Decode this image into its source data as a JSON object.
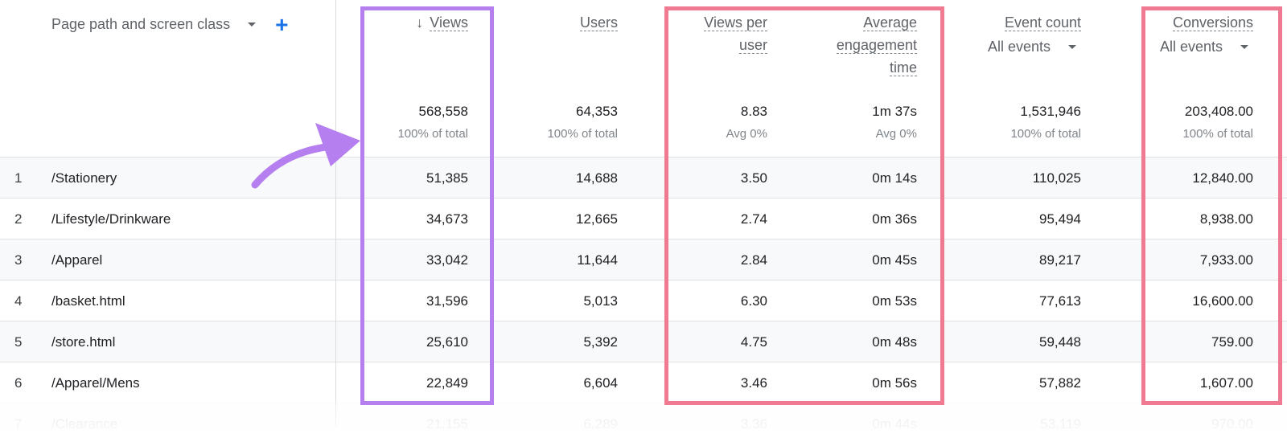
{
  "dimension": {
    "label": "Page path and screen class",
    "dropdown_icon": "caret-down-icon",
    "add_icon": "plus-icon"
  },
  "columns": [
    {
      "key": "views",
      "label_lines": [
        "Views"
      ],
      "sort_icon": "arrow-down-icon",
      "total": "568,558",
      "total_sub": "100% of total"
    },
    {
      "key": "users",
      "label_lines": [
        "Users"
      ],
      "total": "64,353",
      "total_sub": "100% of total"
    },
    {
      "key": "views_per_user",
      "label_lines": [
        "Views per",
        "user"
      ],
      "total": "8.83",
      "total_sub": "Avg 0%"
    },
    {
      "key": "avg_engagement_time",
      "label_lines": [
        "Average",
        "engagement",
        "time"
      ],
      "total": "1m 37s",
      "total_sub": "Avg 0%"
    },
    {
      "key": "event_count",
      "label_lines": [
        "Event count"
      ],
      "filter": "All events",
      "total": "1,531,946",
      "total_sub": "100% of total"
    },
    {
      "key": "conversions",
      "label_lines": [
        "Conversions"
      ],
      "filter": "All events",
      "total": "203,408.00",
      "total_sub": "100% of total"
    }
  ],
  "rows": [
    {
      "index": "1",
      "path": "/Stationery",
      "views": "51,385",
      "users": "14,688",
      "views_per_user": "3.50",
      "avg_engagement_time": "0m 14s",
      "event_count": "110,025",
      "conversions": "12,840.00"
    },
    {
      "index": "2",
      "path": "/Lifestyle/Drinkware",
      "views": "34,673",
      "users": "12,665",
      "views_per_user": "2.74",
      "avg_engagement_time": "0m 36s",
      "event_count": "95,494",
      "conversions": "8,938.00"
    },
    {
      "index": "3",
      "path": "/Apparel",
      "views": "33,042",
      "users": "11,644",
      "views_per_user": "2.84",
      "avg_engagement_time": "0m 45s",
      "event_count": "89,217",
      "conversions": "7,933.00"
    },
    {
      "index": "4",
      "path": "/basket.html",
      "views": "31,596",
      "users": "5,013",
      "views_per_user": "6.30",
      "avg_engagement_time": "0m 53s",
      "event_count": "77,613",
      "conversions": "16,600.00"
    },
    {
      "index": "5",
      "path": "/store.html",
      "views": "25,610",
      "users": "5,392",
      "views_per_user": "4.75",
      "avg_engagement_time": "0m 48s",
      "event_count": "59,448",
      "conversions": "759.00"
    },
    {
      "index": "6",
      "path": "/Apparel/Mens",
      "views": "22,849",
      "users": "6,604",
      "views_per_user": "3.46",
      "avg_engagement_time": "0m 56s",
      "event_count": "57,882",
      "conversions": "1,607.00"
    },
    {
      "index": "7",
      "path": "/Clearance",
      "views": "21,155",
      "users": "6,289",
      "views_per_user": "3.36",
      "avg_engagement_time": "0m 44s",
      "event_count": "53,119",
      "conversions": "970.00"
    }
  ],
  "annotations": {
    "highlight_purple": "#b57ff0",
    "highlight_pink": "#ef7a91",
    "arrow_icon": "curved-arrow-icon"
  }
}
